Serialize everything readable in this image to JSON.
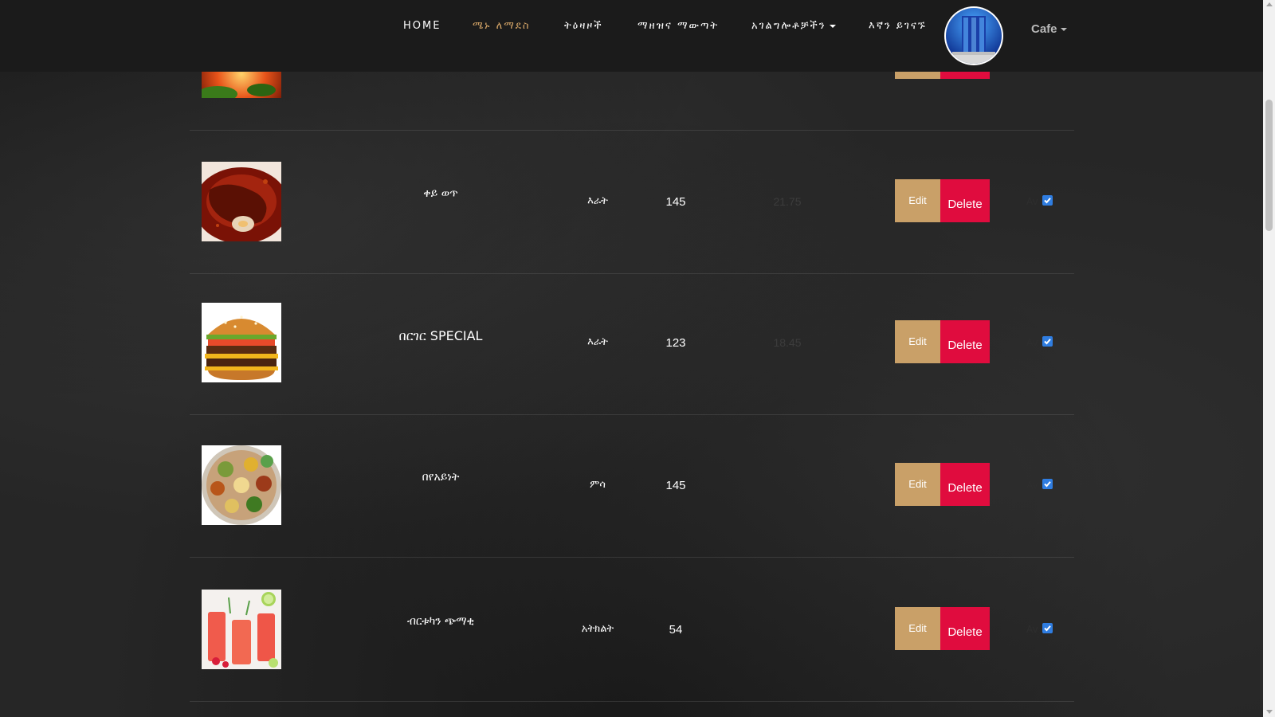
{
  "nav": {
    "items": [
      {
        "label": "HOME",
        "active": false
      },
      {
        "label": "ሜኑ ለማደስ",
        "active": true
      },
      {
        "label": "ትዕዛዞች",
        "active": false
      },
      {
        "label": "ማዘዝና ማውጣት",
        "active": false
      },
      {
        "label": "አገልግሎቶቻችን",
        "active": false,
        "dropdown": true
      },
      {
        "label": "እኛን ይገናኙ",
        "active": false
      }
    ],
    "brand": "Cafe",
    "accent_color": "#d2a366"
  },
  "menu": {
    "rows": [
      {
        "image": "food-photo-partial",
        "name": "",
        "category": "",
        "price": "",
        "discount": "",
        "edit": "Edit",
        "delete": "Delete",
        "available_label": "",
        "available": true
      },
      {
        "image": "stew-photo",
        "name": "ቀይ ወጥ",
        "category": "እራት",
        "price": "145",
        "discount": "21.75",
        "edit": "Edit",
        "delete": "Delete",
        "available_label": "Av",
        "available": true
      },
      {
        "image": "burger-photo",
        "name": "በርገር SPECIAL",
        "category": "እራት",
        "price": "123",
        "discount": "18.45",
        "edit": "Edit",
        "delete": "Delete",
        "available_label": "Av",
        "available": true
      },
      {
        "image": "platter-photo",
        "name": "በየአይነት",
        "category": "ምሳ",
        "price": "145",
        "discount": "",
        "edit": "Edit",
        "delete": "Delete",
        "available_label": "Av",
        "available": true
      },
      {
        "image": "juice-photo",
        "name": "ብርቱካን ጭማቂ",
        "category": "አትክልት",
        "price": "54",
        "discount": "",
        "edit": "Edit",
        "delete": "Delete",
        "available_label": "Av",
        "available": true
      }
    ]
  },
  "colors": {
    "edit_button": "#c9a068",
    "delete_button": "#e00c3e",
    "checkbox": "#2f7de1"
  }
}
